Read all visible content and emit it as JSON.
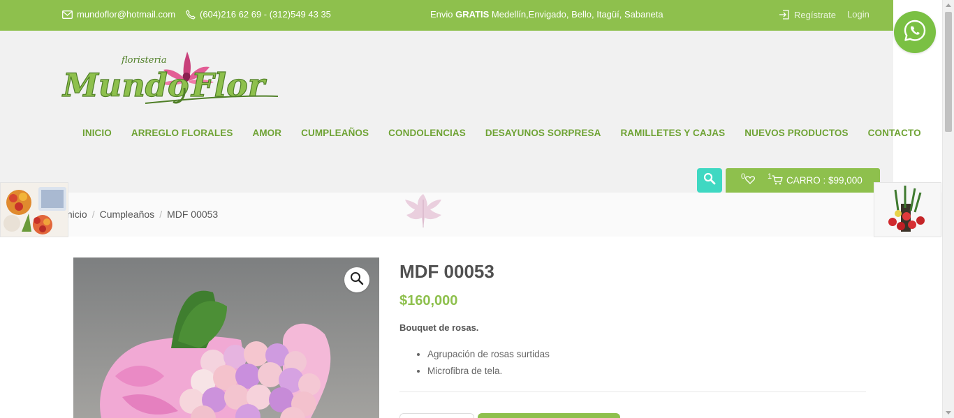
{
  "topbar": {
    "email": "mundoflor@hotmail.com",
    "phones": "(604)216 62 69 - (312)549 43 35",
    "shipping_prefix": "Envio ",
    "shipping_bold": "GRATIS",
    "shipping_rest": " Medellín,Envigado, Bello, Itagüí, Sabaneta",
    "register": "Regístrate",
    "login": "Login"
  },
  "logo": {
    "small_text": "floristeria",
    "brand_left": "Mundo",
    "brand_right": "Flor"
  },
  "nav": {
    "items": [
      {
        "label": "INICIO"
      },
      {
        "label": "ARREGLO FLORALES"
      },
      {
        "label": "AMOR"
      },
      {
        "label": "CUMPLEAÑOS"
      },
      {
        "label": "CONDOLENCIAS"
      },
      {
        "label": "DESAYUNOS SORPRESA"
      },
      {
        "label": "RAMILLETES Y CAJAS"
      },
      {
        "label": "NUEVOS PRODUCTOS"
      },
      {
        "label": "CONTACTO"
      }
    ]
  },
  "cart": {
    "wishlist_count": "0",
    "cart_count": "1",
    "label": "CARRO : $99,000"
  },
  "breadcrumb": {
    "home": "Inicio",
    "category": "Cumpleaños",
    "current": "MDF 00053",
    "separator": "/"
  },
  "product": {
    "title": "MDF 00053",
    "price": "$160,000",
    "description": "Bouquet de rosas.",
    "features": [
      "Agrupación de rosas surtidas",
      "Microfibra de tela."
    ]
  },
  "colors": {
    "brand_green": "#8ec04d",
    "nav_green": "#6fa335",
    "search_teal": "#3fd8c2",
    "whatsapp_green": "#7ac043"
  },
  "icons": {
    "email": "envelope-icon",
    "phone": "phone-icon",
    "register": "sign-in-icon",
    "search": "search-icon",
    "wishlist": "heart-icon",
    "cart": "cart-icon",
    "zoom": "magnifier-icon",
    "whatsapp": "whatsapp-icon"
  }
}
